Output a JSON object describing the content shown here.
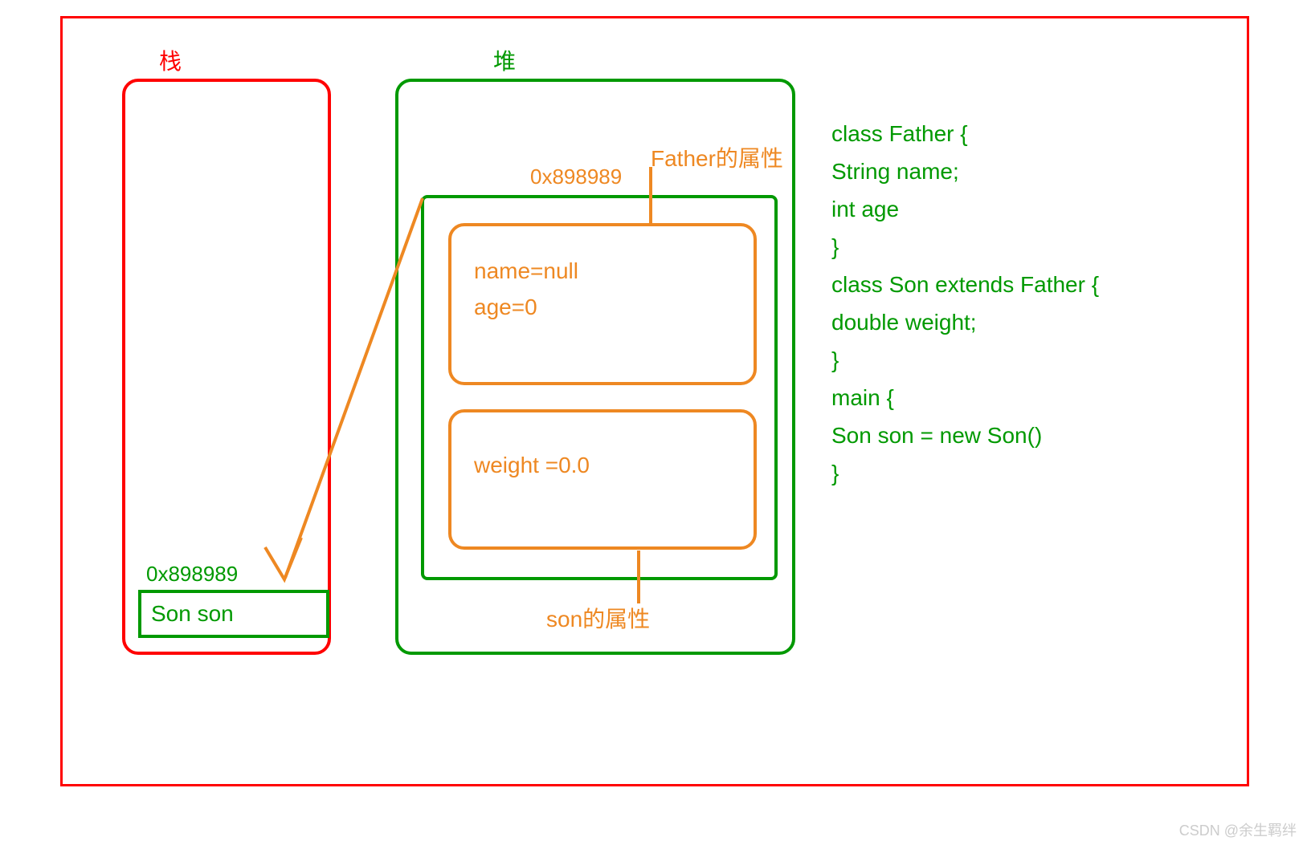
{
  "labels": {
    "stack": "栈",
    "heap": "堆",
    "heap_addr": "0x898989",
    "stack_addr": "0x898989",
    "father_props_label": "Father的属性",
    "son_props_label": "son的属性"
  },
  "father_props": {
    "name": "name=null",
    "age": "age=0"
  },
  "son_props": {
    "weight": "weight =0.0"
  },
  "stack_var": "Son son",
  "code": {
    "l1": "class Father {",
    "l2": " String name;",
    "l3": "int age",
    "l4": "}",
    "l5": "class Son extends Father {",
    "l6": "double weight;",
    "l7": "}",
    "l8": "main {",
    "l9": "Son son = new Son()",
    "l10": "}"
  },
  "watermark": "CSDN @余生羁绊"
}
